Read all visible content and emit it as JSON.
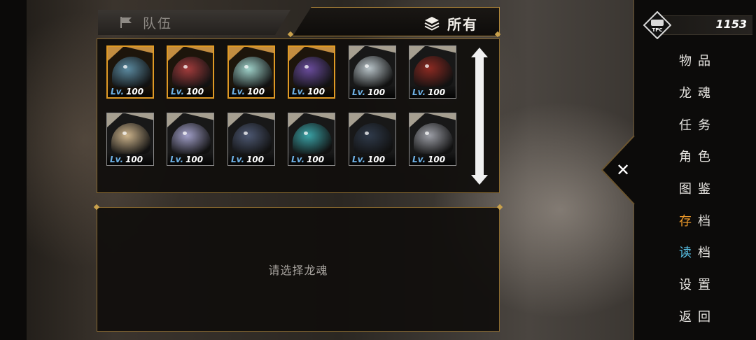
{
  "tabs": {
    "team_label": "队伍",
    "all_label": "所有"
  },
  "cards": [
    {
      "lv_prefix": "Lv.",
      "lv": "100",
      "selected": true,
      "color": "#5b8aa0"
    },
    {
      "lv_prefix": "Lv.",
      "lv": "100",
      "selected": true,
      "color": "#a23c3c"
    },
    {
      "lv_prefix": "Lv.",
      "lv": "100",
      "selected": true,
      "color": "#9fd1c9"
    },
    {
      "lv_prefix": "Lv.",
      "lv": "100",
      "selected": true,
      "color": "#6a4c9c"
    },
    {
      "lv_prefix": "Lv.",
      "lv": "100",
      "selected": false,
      "color": "#b8c3c8"
    },
    {
      "lv_prefix": "Lv.",
      "lv": "100",
      "selected": false,
      "color": "#8c2a22"
    },
    {
      "lv_prefix": "Lv.",
      "lv": "100",
      "selected": false,
      "color": "#cdb48c"
    },
    {
      "lv_prefix": "Lv.",
      "lv": "100",
      "selected": false,
      "color": "#a19fc8"
    },
    {
      "lv_prefix": "Lv.",
      "lv": "100",
      "selected": false,
      "color": "#4d5872"
    },
    {
      "lv_prefix": "Lv.",
      "lv": "100",
      "selected": false,
      "color": "#3aa2a6"
    },
    {
      "lv_prefix": "Lv.",
      "lv": "100",
      "selected": false,
      "color": "#2f3a4a"
    },
    {
      "lv_prefix": "Lv.",
      "lv": "100",
      "selected": false,
      "color": "#9c9ea6"
    }
  ],
  "detail": {
    "hint": "请选择龙魂"
  },
  "currency": {
    "badge_text": "TPC",
    "amount": "1153"
  },
  "menu": {
    "close_icon": "close-icon",
    "items": [
      {
        "label": "物品"
      },
      {
        "label": "龙魂"
      },
      {
        "label": "任务"
      },
      {
        "label": "角色"
      },
      {
        "label": "图鉴"
      },
      {
        "first": "存",
        "rest": "档",
        "accent": "#ee9a2a"
      },
      {
        "first": "读",
        "rest": "档",
        "accent": "#58c1e6"
      },
      {
        "label": "设置"
      },
      {
        "label": "返回"
      }
    ]
  },
  "colors": {
    "frame_gold": "#b0873a",
    "selected_orange": "#e09a25",
    "lv_blue": "#6fb3e8"
  }
}
